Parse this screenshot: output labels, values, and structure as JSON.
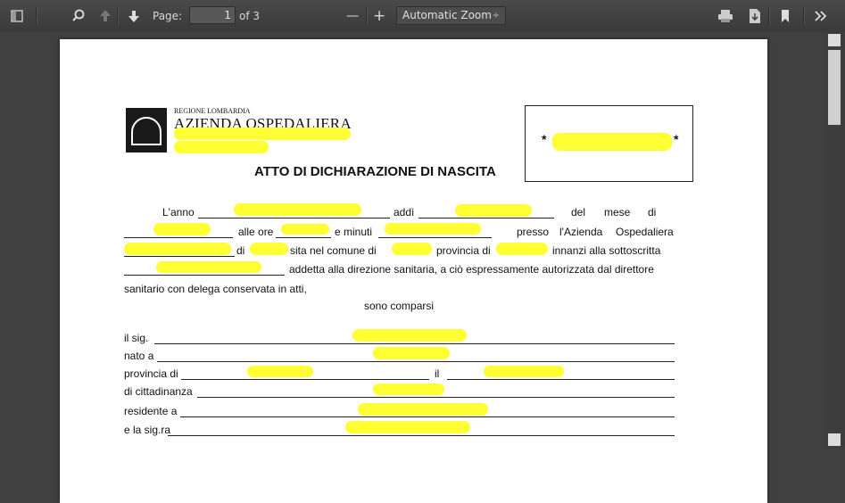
{
  "toolbar": {
    "page_label": "Page:",
    "page_value": "1",
    "page_total": "of 3",
    "zoom_value": "Automatic Zoom",
    "zoom_arrow": "÷",
    "minus": "—",
    "plus": "+",
    "icons": [
      "sidebar-toggle-icon",
      "search-icon",
      "previous-page-icon",
      "next-page-icon",
      "zoom-out-icon",
      "zoom-in-icon",
      "print-icon",
      "download-icon",
      "bookmark-icon",
      "tools-icon"
    ]
  },
  "document": {
    "region": "REGIONE LOMBARDIA",
    "org": "AZIENDA OSPEDALIERA",
    "title": "ATTO DI DICHIARAZIONE DI NASCITA",
    "stamp_left": "*",
    "stamp_right": "*",
    "p1_l1_a": "L'anno",
    "p1_l1_b": "addì",
    "p1_l1_c": "del",
    "p1_l1_d": "mese",
    "p1_l1_e": "di",
    "p1_l2_a": "alle ore",
    "p1_l2_b": "e minuti",
    "p1_l2_c": "presso",
    "p1_l2_d": "l'Azienda",
    "p1_l2_e": "Ospedaliera",
    "p1_l3_a": "di",
    "p1_l3_b": "sita nel comune di",
    "p1_l3_c": "provincia di",
    "p1_l3_d": "innanzi alla sottoscritta",
    "p1_l4_a": "addetta alla direzione sanitaria, a ciò espressamente autorizzata dal direttore",
    "p1_l5": "sanitario con delega conservata in atti,",
    "sono": "sono comparsi",
    "f1": "il sig.",
    "f2": "nato a",
    "f3": "provincia di",
    "f3b": "il",
    "f4": "di cittadinanza",
    "f5": "residente a",
    "f6": "e la sig.ra"
  },
  "colors": {
    "highlight": "#ffff33",
    "toolbar": "#3f3f3f",
    "background": "#404040"
  }
}
